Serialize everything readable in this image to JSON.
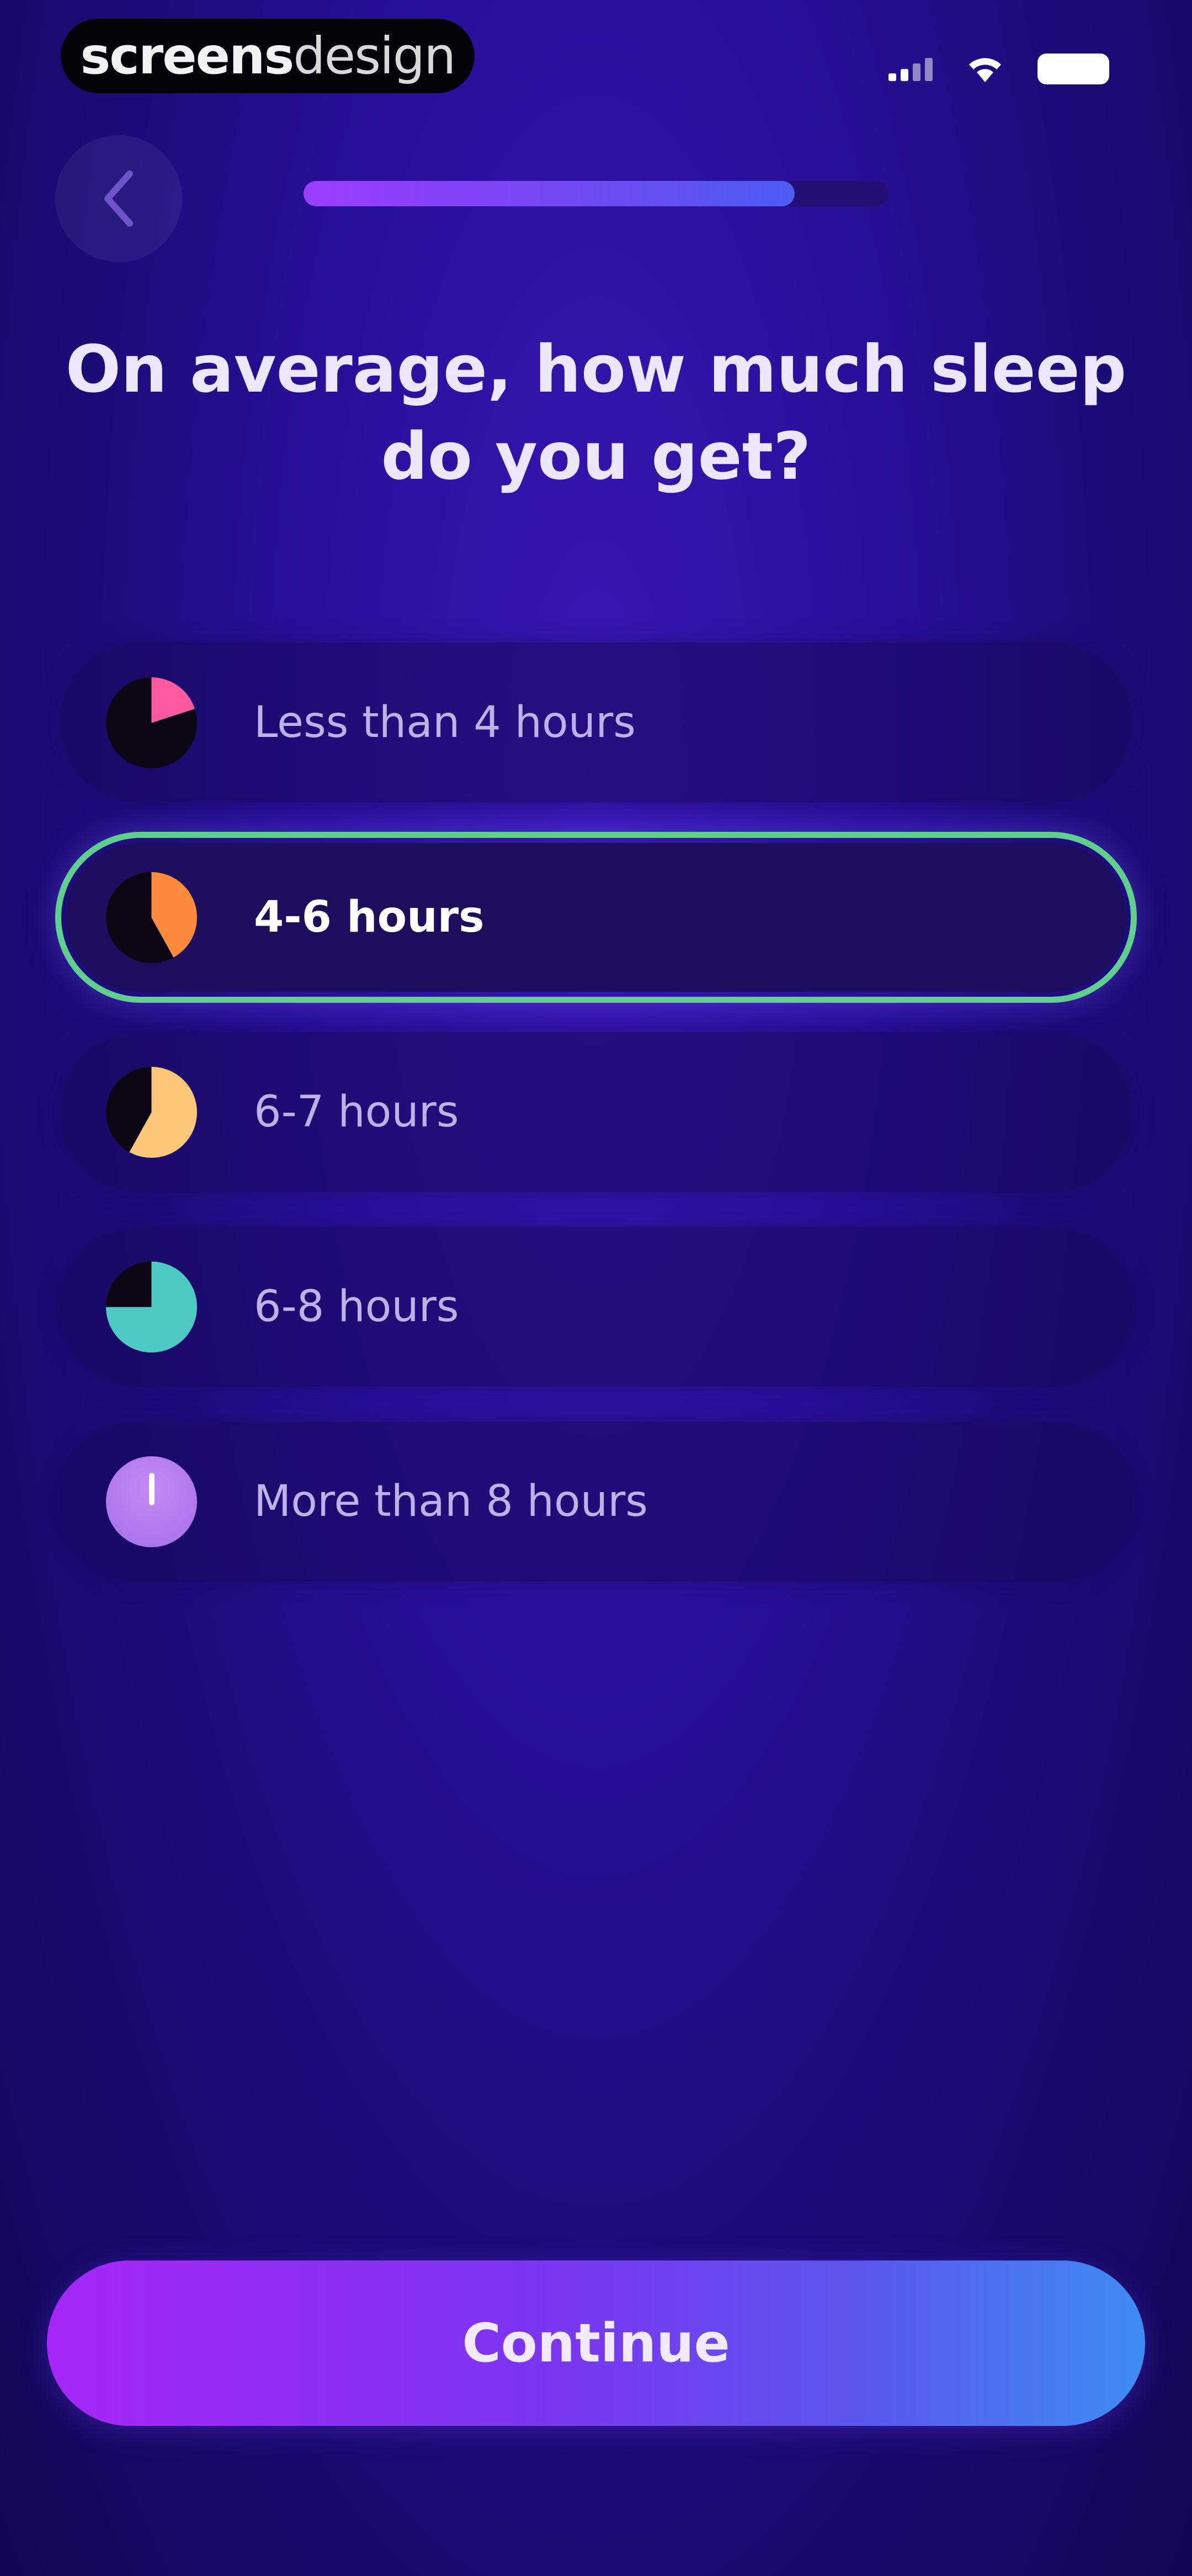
{
  "status_bar": {
    "brand_part1": "screens",
    "brand_part2": "design"
  },
  "progress": {
    "fraction": 0.84
  },
  "question": {
    "title": "On average, how much sleep do you get?"
  },
  "options": [
    {
      "label": "Less than 4 hours",
      "selected": false,
      "color": "#ff5aa0",
      "fraction": 0.2
    },
    {
      "label": "4-6 hours",
      "selected": true,
      "color": "#ff8a3d",
      "fraction": 0.42
    },
    {
      "label": "6-7 hours",
      "selected": false,
      "color": "#ffc77a",
      "fraction": 0.58
    },
    {
      "label": "6-8 hours",
      "selected": false,
      "color": "#4fc9c4",
      "fraction": 0.75
    },
    {
      "label": "More than 8 hours",
      "selected": false,
      "color": "#a56ee8",
      "fraction": 1.0
    }
  ],
  "continue_button": {
    "label": "Continue"
  },
  "colors": {
    "accent_green": "#5fcf8e",
    "background": "#28109a"
  }
}
